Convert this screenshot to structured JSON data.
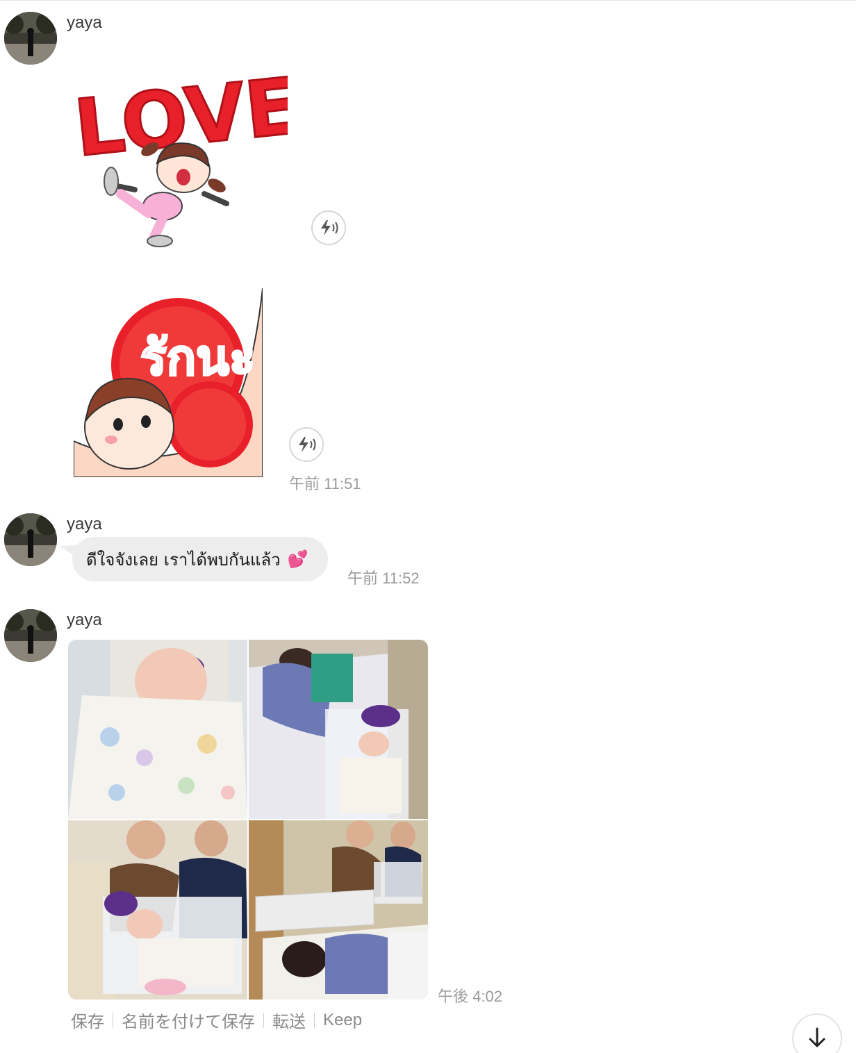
{
  "messages": [
    {
      "sender": "yaya",
      "type": "stickers",
      "stickers": [
        {
          "text": "LOVE"
        },
        {
          "text": "รักนะ"
        }
      ],
      "time": "午前 11:51"
    },
    {
      "sender": "yaya",
      "type": "text",
      "text": "ดีใจจังเลย เราได้พบกันแล้ว",
      "emoji": "💕",
      "time": "午前 11:52"
    },
    {
      "sender": "yaya",
      "type": "photos",
      "photo_count": 4,
      "time": "午後 4:02"
    }
  ],
  "photo_actions": {
    "save": "保存",
    "save_as": "名前を付けて保存",
    "forward": "転送",
    "keep": "Keep"
  },
  "icons": {
    "sound": "sound-play-icon",
    "scroll_down": "arrow-down-icon"
  },
  "colors": {
    "bubble": "#ededed",
    "timestamp": "#9a9a9a",
    "sticker_red": "#e8202a",
    "sticker_pink": "#e85aa8"
  }
}
